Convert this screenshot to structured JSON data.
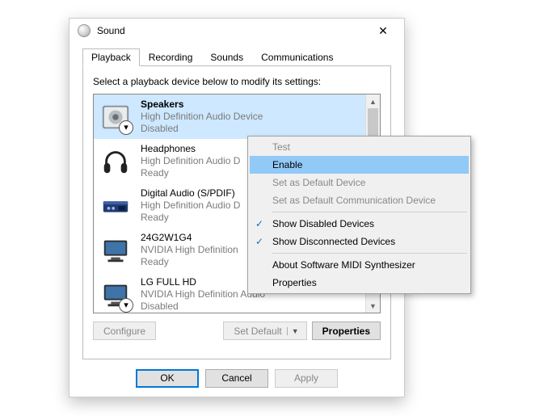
{
  "window": {
    "title": "Sound"
  },
  "tabs": [
    {
      "label": "Playback",
      "active": true
    },
    {
      "label": "Recording",
      "active": false
    },
    {
      "label": "Sounds",
      "active": false
    },
    {
      "label": "Communications",
      "active": false
    }
  ],
  "hint": "Select a playback device below to modify its settings:",
  "devices": [
    {
      "name": "Speakers",
      "sub": "High Definition Audio Device",
      "status": "Disabled",
      "selected": true,
      "badge": "down"
    },
    {
      "name": "Headphones",
      "sub": "High Definition Audio D",
      "status": "Ready",
      "selected": false,
      "badge": null
    },
    {
      "name": "Digital Audio (S/PDIF)",
      "sub": "High Definition Audio D",
      "status": "Ready",
      "selected": false,
      "badge": null
    },
    {
      "name": "24G2W1G4",
      "sub": "NVIDIA High Definition",
      "status": "Ready",
      "selected": false,
      "badge": null
    },
    {
      "name": "LG FULL HD",
      "sub": "NVIDIA High Definition Audio",
      "status": "Disabled",
      "selected": false,
      "badge": "down"
    }
  ],
  "panel_buttons": {
    "configure": "Configure",
    "set_default": "Set Default",
    "properties": "Properties"
  },
  "footer": {
    "ok": "OK",
    "cancel": "Cancel",
    "apply": "Apply"
  },
  "context_menu": [
    {
      "label": "Test",
      "kind": "item",
      "enabled": false,
      "checked": false,
      "hover": false
    },
    {
      "label": "Enable",
      "kind": "item",
      "enabled": true,
      "checked": false,
      "hover": true
    },
    {
      "label": "Set as Default Device",
      "kind": "item",
      "enabled": false,
      "checked": false,
      "hover": false
    },
    {
      "label": "Set as Default Communication Device",
      "kind": "item",
      "enabled": false,
      "checked": false,
      "hover": false
    },
    {
      "kind": "sep"
    },
    {
      "label": "Show Disabled Devices",
      "kind": "item",
      "enabled": true,
      "checked": true,
      "hover": false
    },
    {
      "label": "Show Disconnected Devices",
      "kind": "item",
      "enabled": true,
      "checked": true,
      "hover": false
    },
    {
      "kind": "sep"
    },
    {
      "label": "About Software MIDI Synthesizer",
      "kind": "item",
      "enabled": true,
      "checked": false,
      "hover": false
    },
    {
      "label": "Properties",
      "kind": "item",
      "enabled": true,
      "checked": false,
      "hover": false
    }
  ]
}
